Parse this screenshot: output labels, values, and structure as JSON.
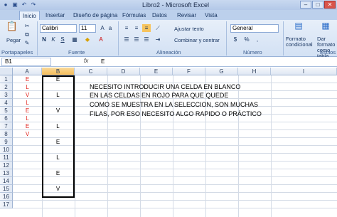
{
  "window": {
    "title": "Libro2 - Microsoft Excel",
    "controls": [
      "–",
      "□",
      "✕"
    ]
  },
  "tabs": [
    "Inicio",
    "Insertar",
    "Diseño de página",
    "Fórmulas",
    "Datos",
    "Revisar",
    "Vista"
  ],
  "ribbon": {
    "paste_label": "Pegar",
    "clipboard_label": "Portapapeles",
    "font_name": "Calibri",
    "font_size": "11",
    "font_group_label": "Fuente",
    "wrap_text": "Ajustar texto",
    "merge_center": "Combinar y centrar",
    "align_group_label": "Alineación",
    "number_format": "General",
    "number_group_label": "Número",
    "cond_format": "Formato condicional",
    "format_table": "Dar formato como tabla",
    "styles_group_label": "Estilos"
  },
  "formula_bar": {
    "name_box": "B1",
    "fx": "fx",
    "value": "E"
  },
  "columns": [
    "A",
    "B",
    "C",
    "D",
    "E",
    "F",
    "G",
    "H",
    "I"
  ],
  "rows": [
    "1",
    "2",
    "3",
    "4",
    "5",
    "6",
    "7",
    "8",
    "9",
    "10",
    "11",
    "12",
    "13",
    "14",
    "15",
    "16",
    "17"
  ],
  "col_a": [
    "E",
    "L",
    "V",
    "L",
    "E",
    "L",
    "E",
    "V"
  ],
  "col_b": [
    "E",
    "",
    "L",
    "",
    "V",
    "",
    "L",
    "",
    "E",
    "",
    "L",
    "",
    "E",
    "",
    "V"
  ],
  "note_lines": [
    "NECESITO INTRODUCIR UNA CELDA EN BLANCO",
    "EN LAS CELDAS EN ROJO PARA QUE QUEDE",
    "COMO SE MUESTRA EN LA SELECCION, SON MUCHAS",
    "FILAS, POR ESO NECESITO ALGO RAPIDO O PRÁCTICO"
  ],
  "colors": {
    "red_text": "#e0211b",
    "selected_header": "#f5bd5a",
    "ribbon": "#dce7f5"
  }
}
